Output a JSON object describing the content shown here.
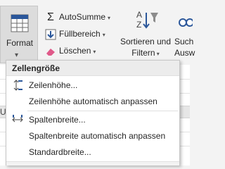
{
  "ribbon": {
    "edge_letter": "n",
    "format_label": "Format",
    "autosum_label": "AutoSumme",
    "fill_label": "Füllbereich",
    "clear_label": "Löschen",
    "sort_label_1": "Sortieren und",
    "sort_label_2": "Filtern",
    "search_label_1": "Such",
    "search_label_2": "Ausw"
  },
  "sheet": {
    "cell_ref": "U"
  },
  "menu": {
    "section_title": "Zellengröße",
    "items": [
      {
        "label": "Zeilenhöhe...",
        "icon": "row-height-icon"
      },
      {
        "label": "Zeilenhöhe automatisch anpassen"
      },
      {
        "label": "Spaltenbreite...",
        "icon": "column-width-icon"
      },
      {
        "label": "Spaltenbreite automatisch anpassen"
      },
      {
        "label": "Standardbreite..."
      }
    ]
  },
  "colors": {
    "accent_blue": "#2b579a",
    "eraser_pink": "#e05a8a"
  }
}
